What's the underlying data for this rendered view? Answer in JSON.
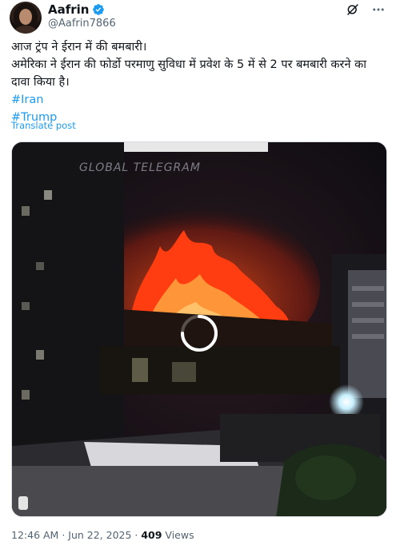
{
  "author": {
    "display_name": "Aafrin",
    "handle": "@Aafrin7866",
    "verified": true,
    "avatar_icon": "profile-photo"
  },
  "actions": {
    "grok_icon": "grok-icon",
    "more_icon": "more-dots-icon"
  },
  "tweet": {
    "line1": "आज ट्रंप ने ईरान में की बमबारी।",
    "line2": "अमेरिका ने ईरान की फोर्डो परमाणु सुविधा में प्रवेश के 5 में से 2 पर बमबारी करने का",
    "line3": "दावा किया है।",
    "hashtags": [
      "#Iran",
      "#Trump"
    ],
    "translate_label": "Translate post"
  },
  "media": {
    "watermark": "GLOBAL TELEGRAM",
    "type": "video",
    "loading_icon": "loading-spinner-icon"
  },
  "meta": {
    "time": "12:46 AM",
    "separator": " · ",
    "date": "Jun 22, 2025",
    "views_count": "409",
    "views_label": " Views"
  },
  "colors": {
    "accent": "#1d9bf0",
    "secondary_text": "#536471",
    "primary_text": "#0f1419",
    "fire": "#ff4a12"
  }
}
